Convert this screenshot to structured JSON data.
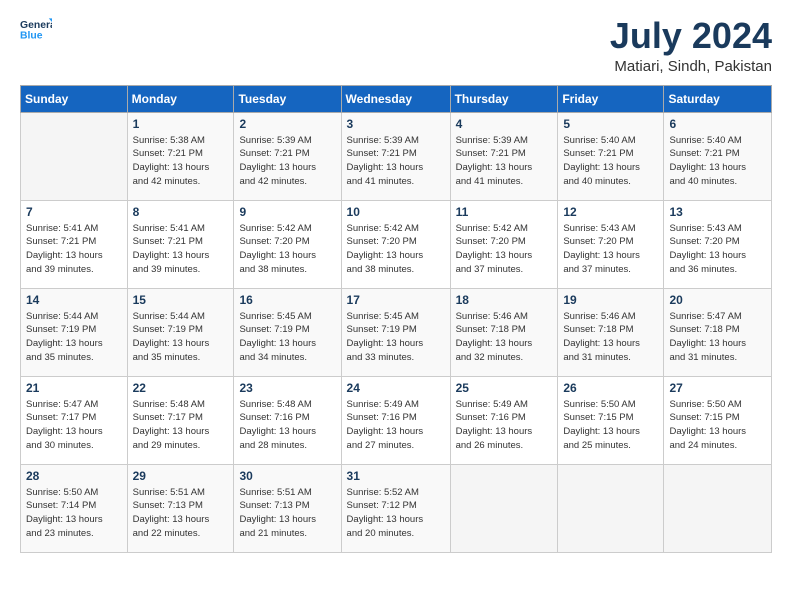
{
  "header": {
    "logo_line1": "General",
    "logo_line2": "Blue",
    "month": "July 2024",
    "location": "Matiari, Sindh, Pakistan"
  },
  "weekdays": [
    "Sunday",
    "Monday",
    "Tuesday",
    "Wednesday",
    "Thursday",
    "Friday",
    "Saturday"
  ],
  "weeks": [
    [
      {
        "date": "",
        "info": ""
      },
      {
        "date": "1",
        "info": "Sunrise: 5:38 AM\nSunset: 7:21 PM\nDaylight: 13 hours\nand 42 minutes."
      },
      {
        "date": "2",
        "info": "Sunrise: 5:39 AM\nSunset: 7:21 PM\nDaylight: 13 hours\nand 42 minutes."
      },
      {
        "date": "3",
        "info": "Sunrise: 5:39 AM\nSunset: 7:21 PM\nDaylight: 13 hours\nand 41 minutes."
      },
      {
        "date": "4",
        "info": "Sunrise: 5:39 AM\nSunset: 7:21 PM\nDaylight: 13 hours\nand 41 minutes."
      },
      {
        "date": "5",
        "info": "Sunrise: 5:40 AM\nSunset: 7:21 PM\nDaylight: 13 hours\nand 40 minutes."
      },
      {
        "date": "6",
        "info": "Sunrise: 5:40 AM\nSunset: 7:21 PM\nDaylight: 13 hours\nand 40 minutes."
      }
    ],
    [
      {
        "date": "7",
        "info": "Sunrise: 5:41 AM\nSunset: 7:21 PM\nDaylight: 13 hours\nand 39 minutes."
      },
      {
        "date": "8",
        "info": "Sunrise: 5:41 AM\nSunset: 7:21 PM\nDaylight: 13 hours\nand 39 minutes."
      },
      {
        "date": "9",
        "info": "Sunrise: 5:42 AM\nSunset: 7:20 PM\nDaylight: 13 hours\nand 38 minutes."
      },
      {
        "date": "10",
        "info": "Sunrise: 5:42 AM\nSunset: 7:20 PM\nDaylight: 13 hours\nand 38 minutes."
      },
      {
        "date": "11",
        "info": "Sunrise: 5:42 AM\nSunset: 7:20 PM\nDaylight: 13 hours\nand 37 minutes."
      },
      {
        "date": "12",
        "info": "Sunrise: 5:43 AM\nSunset: 7:20 PM\nDaylight: 13 hours\nand 37 minutes."
      },
      {
        "date": "13",
        "info": "Sunrise: 5:43 AM\nSunset: 7:20 PM\nDaylight: 13 hours\nand 36 minutes."
      }
    ],
    [
      {
        "date": "14",
        "info": "Sunrise: 5:44 AM\nSunset: 7:19 PM\nDaylight: 13 hours\nand 35 minutes."
      },
      {
        "date": "15",
        "info": "Sunrise: 5:44 AM\nSunset: 7:19 PM\nDaylight: 13 hours\nand 35 minutes."
      },
      {
        "date": "16",
        "info": "Sunrise: 5:45 AM\nSunset: 7:19 PM\nDaylight: 13 hours\nand 34 minutes."
      },
      {
        "date": "17",
        "info": "Sunrise: 5:45 AM\nSunset: 7:19 PM\nDaylight: 13 hours\nand 33 minutes."
      },
      {
        "date": "18",
        "info": "Sunrise: 5:46 AM\nSunset: 7:18 PM\nDaylight: 13 hours\nand 32 minutes."
      },
      {
        "date": "19",
        "info": "Sunrise: 5:46 AM\nSunset: 7:18 PM\nDaylight: 13 hours\nand 31 minutes."
      },
      {
        "date": "20",
        "info": "Sunrise: 5:47 AM\nSunset: 7:18 PM\nDaylight: 13 hours\nand 31 minutes."
      }
    ],
    [
      {
        "date": "21",
        "info": "Sunrise: 5:47 AM\nSunset: 7:17 PM\nDaylight: 13 hours\nand 30 minutes."
      },
      {
        "date": "22",
        "info": "Sunrise: 5:48 AM\nSunset: 7:17 PM\nDaylight: 13 hours\nand 29 minutes."
      },
      {
        "date": "23",
        "info": "Sunrise: 5:48 AM\nSunset: 7:16 PM\nDaylight: 13 hours\nand 28 minutes."
      },
      {
        "date": "24",
        "info": "Sunrise: 5:49 AM\nSunset: 7:16 PM\nDaylight: 13 hours\nand 27 minutes."
      },
      {
        "date": "25",
        "info": "Sunrise: 5:49 AM\nSunset: 7:16 PM\nDaylight: 13 hours\nand 26 minutes."
      },
      {
        "date": "26",
        "info": "Sunrise: 5:50 AM\nSunset: 7:15 PM\nDaylight: 13 hours\nand 25 minutes."
      },
      {
        "date": "27",
        "info": "Sunrise: 5:50 AM\nSunset: 7:15 PM\nDaylight: 13 hours\nand 24 minutes."
      }
    ],
    [
      {
        "date": "28",
        "info": "Sunrise: 5:50 AM\nSunset: 7:14 PM\nDaylight: 13 hours\nand 23 minutes."
      },
      {
        "date": "29",
        "info": "Sunrise: 5:51 AM\nSunset: 7:13 PM\nDaylight: 13 hours\nand 22 minutes."
      },
      {
        "date": "30",
        "info": "Sunrise: 5:51 AM\nSunset: 7:13 PM\nDaylight: 13 hours\nand 21 minutes."
      },
      {
        "date": "31",
        "info": "Sunrise: 5:52 AM\nSunset: 7:12 PM\nDaylight: 13 hours\nand 20 minutes."
      },
      {
        "date": "",
        "info": ""
      },
      {
        "date": "",
        "info": ""
      },
      {
        "date": "",
        "info": ""
      }
    ]
  ]
}
